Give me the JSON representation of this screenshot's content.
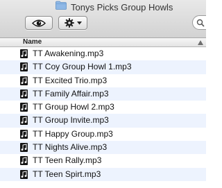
{
  "window": {
    "title": "Tonys Picks Group Howls",
    "title_icon": "folder-icon"
  },
  "toolbar": {
    "quicklook_icon": "eye-icon",
    "action_icon": "gear-icon",
    "action_menu_icon": "chevron-down-icon",
    "search_icon": "search-icon"
  },
  "columns": {
    "name_label": "Name",
    "sort_icon": "sort-ascending-arrow-icon"
  },
  "files": [
    {
      "name": "TT Awakening.mp3",
      "icon": "audio-file-icon"
    },
    {
      "name": "TT Coy Group Howl 1.mp3",
      "icon": "audio-file-icon"
    },
    {
      "name": "TT Excited Trio.mp3",
      "icon": "audio-file-icon"
    },
    {
      "name": "TT Family Affair.mp3",
      "icon": "audio-file-icon"
    },
    {
      "name": "TT Group Howl 2.mp3",
      "icon": "audio-file-icon"
    },
    {
      "name": "TT Group Invite.mp3",
      "icon": "audio-file-icon"
    },
    {
      "name": "TT Happy Group.mp3",
      "icon": "audio-file-icon"
    },
    {
      "name": "TT Nights Alive.mp3",
      "icon": "audio-file-icon"
    },
    {
      "name": "TT Teen Rally.mp3",
      "icon": "audio-file-icon"
    },
    {
      "name": "TT Teen Spirt.mp3",
      "icon": "audio-file-icon"
    }
  ],
  "colors": {
    "row_alternate": "#edf3fe",
    "toolbar_gradient_top": "#e8e8e8",
    "toolbar_gradient_bottom": "#d2d2d2"
  }
}
